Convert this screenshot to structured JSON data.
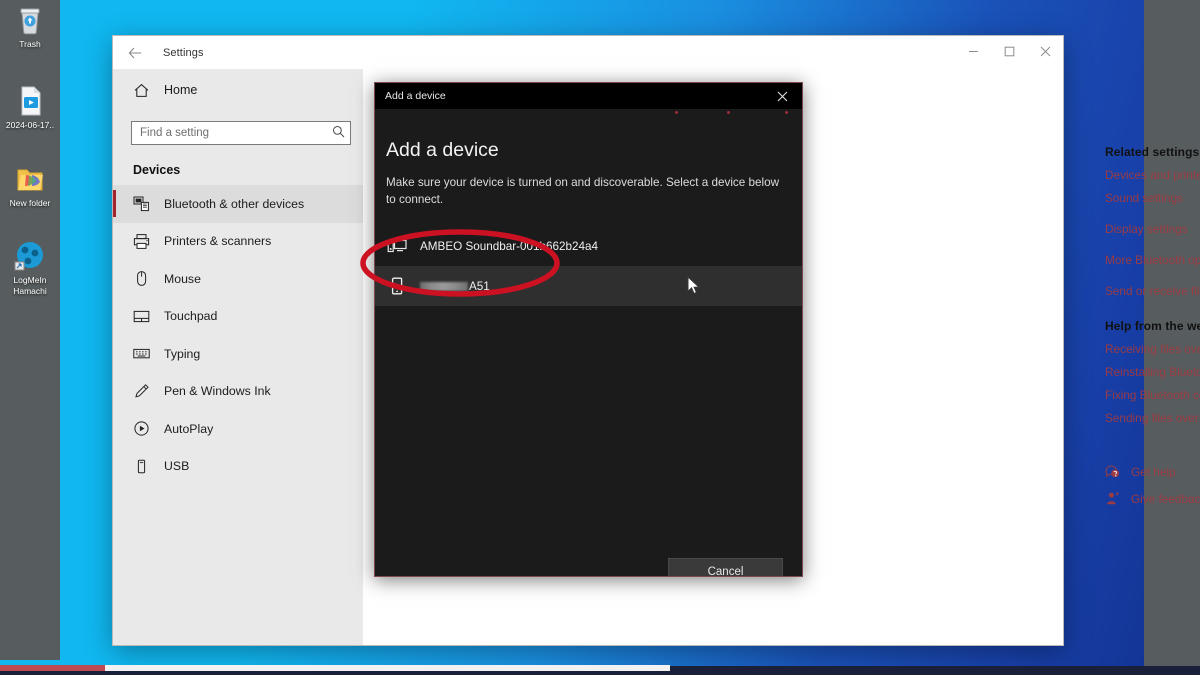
{
  "desktop": {
    "icons": [
      {
        "name": "trash-icon",
        "label": "Trash"
      },
      {
        "name": "video-file-icon",
        "label": "2024-06-17.."
      },
      {
        "name": "folder-icon",
        "label": "New folder"
      },
      {
        "name": "logmein-hamachi-icon",
        "label": "LogMeIn\nHamachi"
      }
    ]
  },
  "settings_window": {
    "title": "Settings",
    "back_icon": "back-arrow-icon",
    "controls": {
      "minimize": "minimize-icon",
      "maximize": "maximize-icon",
      "close": "close-icon"
    }
  },
  "sidebar": {
    "home_label": "Home",
    "home_icon": "home-icon",
    "search": {
      "placeholder": "Find a setting",
      "value": "",
      "icon": "search-icon"
    },
    "section_title": "Devices",
    "items": [
      {
        "label": "Bluetooth & other devices",
        "icon": "bluetooth-devices-icon",
        "selected": true
      },
      {
        "label": "Printers & scanners",
        "icon": "printer-icon",
        "selected": false
      },
      {
        "label": "Mouse",
        "icon": "mouse-icon",
        "selected": false
      },
      {
        "label": "Touchpad",
        "icon": "touchpad-icon",
        "selected": false
      },
      {
        "label": "Typing",
        "icon": "keyboard-icon",
        "selected": false
      },
      {
        "label": "Pen & Windows Ink",
        "icon": "pen-icon",
        "selected": false
      },
      {
        "label": "AutoPlay",
        "icon": "autoplay-icon",
        "selected": false
      },
      {
        "label": "USB",
        "icon": "usb-icon",
        "selected": false
      }
    ],
    "accent_color": "#a4262c"
  },
  "right_panel": {
    "related_heading": "Related settings",
    "related_links": [
      "Devices and printers",
      "Sound settings",
      "Display settings",
      "More Bluetooth options",
      "Send or receive files via Bluetooth"
    ],
    "help_heading": "Help from the web",
    "help_links": [
      "Receiving files over bluetooth",
      "Reinstalling Bluetooth drivers",
      "Fixing Bluetooth connections",
      "Sending files over Bluetooth"
    ],
    "footer_links": [
      {
        "label": "Get help",
        "icon": "get-help-icon"
      },
      {
        "label": "Give feedback",
        "icon": "give-feedback-icon"
      }
    ],
    "link_color": "#9b3b44"
  },
  "dialog": {
    "titlebar_text": "Add a device",
    "close_icon": "close-icon",
    "heading": "Add a device",
    "subtext": "Make sure your device is turned on and discoverable. Select a device below to connect.",
    "devices": [
      {
        "name": "AMBEO Soundbar-001b662b24a4",
        "icon": "display-device-icon",
        "redacted": false,
        "selected": false
      },
      {
        "name": "A51",
        "icon": "phone-icon",
        "redacted": true,
        "selected": true
      }
    ],
    "cancel_label": "Cancel"
  },
  "annotation": {
    "shape": "ellipse",
    "color": "#cc1122",
    "target": "A51"
  }
}
